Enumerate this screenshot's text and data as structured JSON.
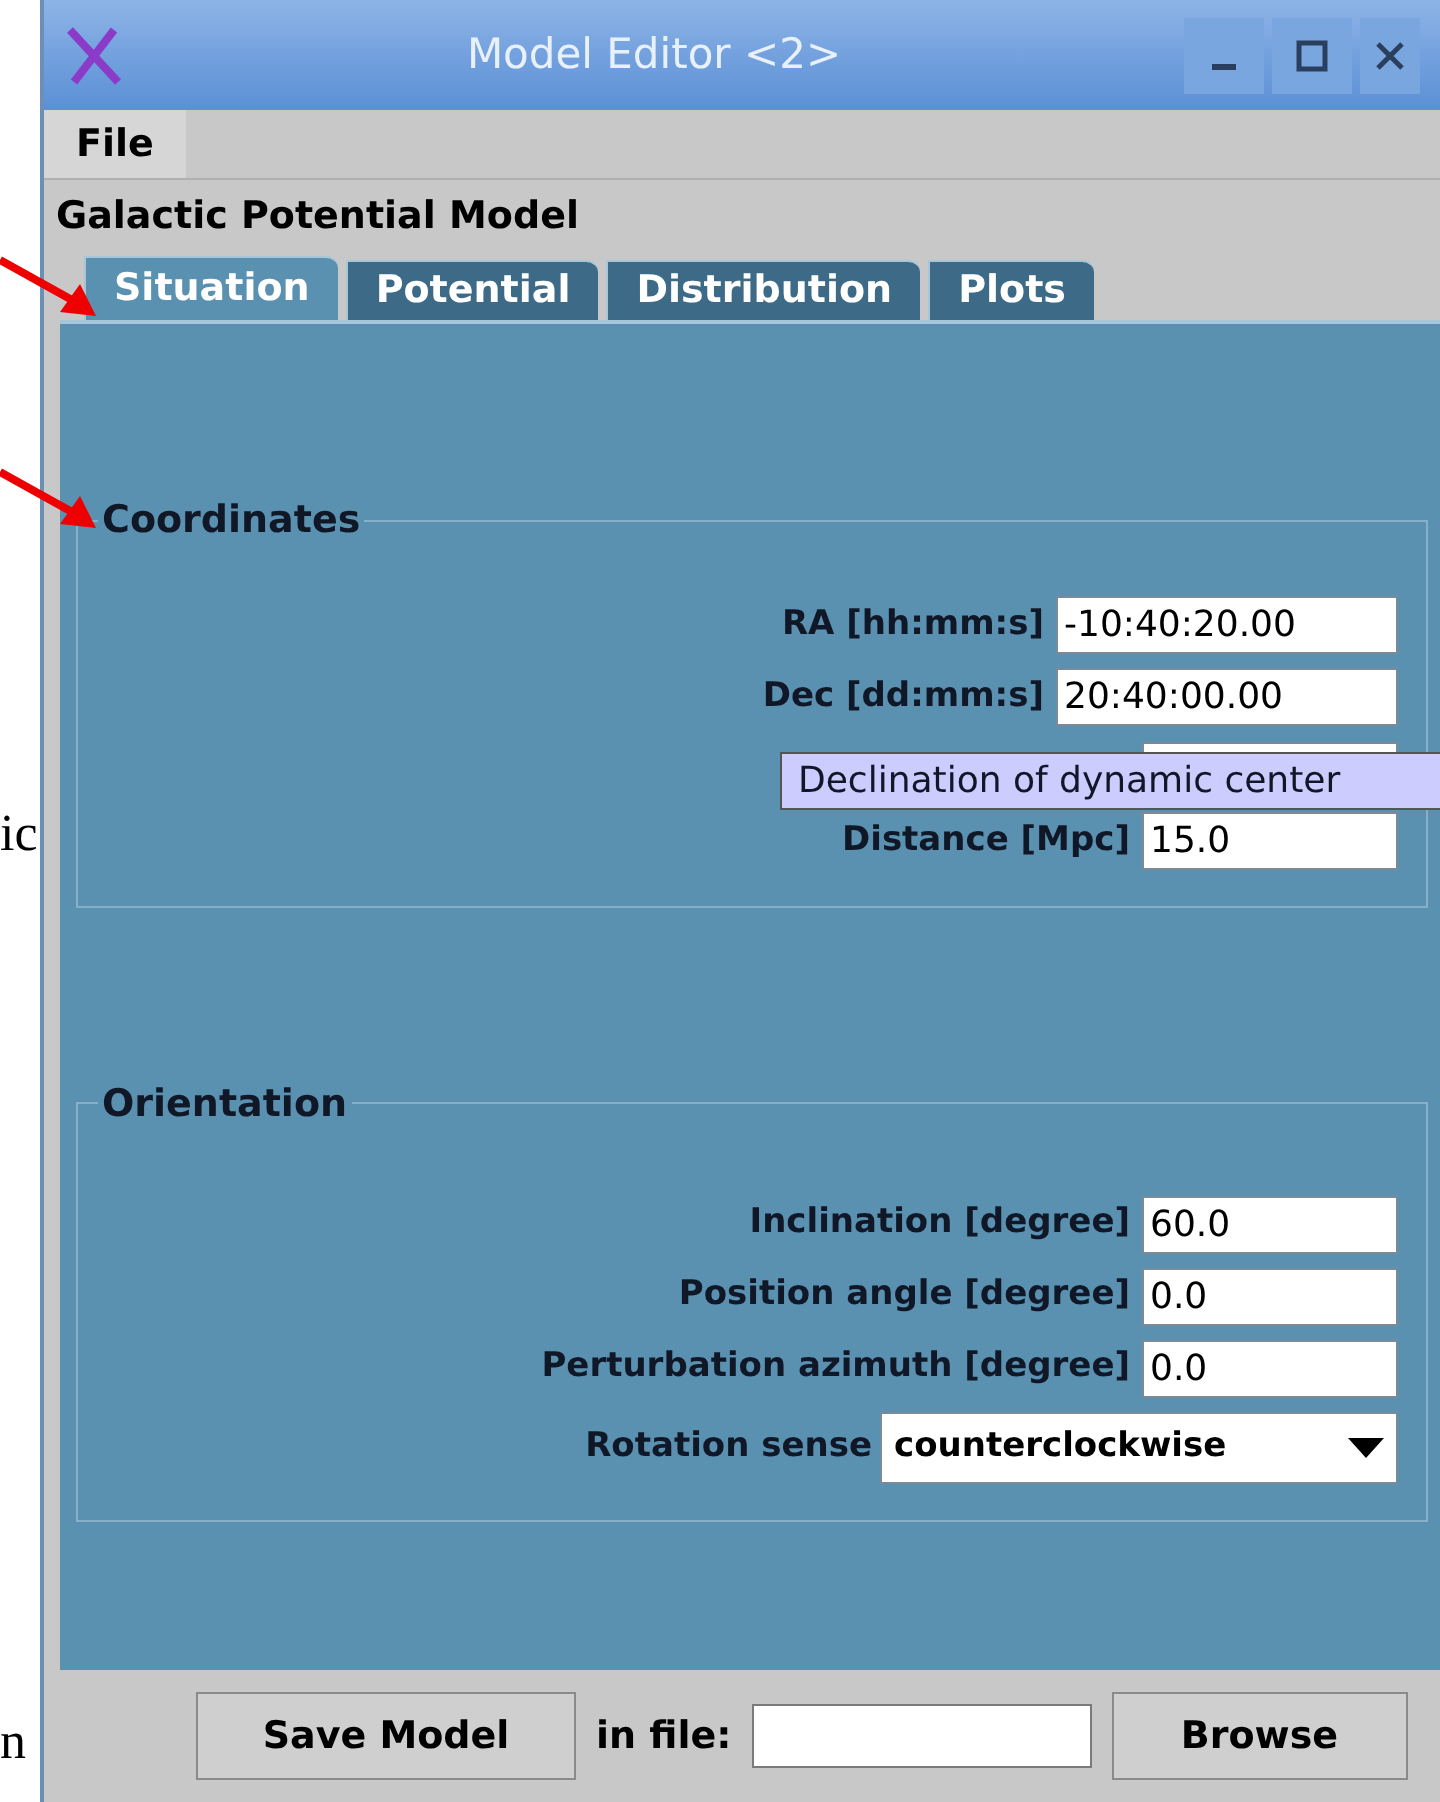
{
  "margin_fragments": [
    "ic",
    "n"
  ],
  "window": {
    "title": "Model Editor <2>"
  },
  "menu": [
    "File"
  ],
  "heading": "Galactic Potential Model",
  "tabs": [
    {
      "label": "Situation",
      "selected": true
    },
    {
      "label": "Potential",
      "selected": false
    },
    {
      "label": "Distribution",
      "selected": false
    },
    {
      "label": "Plots",
      "selected": false
    }
  ],
  "groups": [
    {
      "title": "Coordinates",
      "rows": [
        {
          "kind": "wide_field",
          "label": "RA [hh:mm:s]",
          "value": "-10:40:20.00"
        },
        {
          "kind": "wide_field",
          "label": "Dec [dd:mm:s]",
          "value": "20:40:00.00"
        },
        {
          "kind": "hidden"
        },
        {
          "kind": "field",
          "label": "Distance [Mpc]",
          "value": "15.0"
        }
      ]
    },
    {
      "title": "Orientation",
      "rows": [
        {
          "kind": "field",
          "label": "Inclination [degree]",
          "value": "60.0"
        },
        {
          "kind": "field",
          "label": "Position angle [degree]",
          "value": "0.0"
        },
        {
          "kind": "field",
          "label": "Perturbation azimuth [degree]",
          "value": "0.0"
        },
        {
          "kind": "select",
          "label": "Rotation sense",
          "value": "counterclockwise"
        }
      ]
    }
  ],
  "tooltip": "Declination of dynamic center",
  "footer": {
    "save": "Save Model",
    "file_label": "in file:",
    "browse": "Browse"
  }
}
